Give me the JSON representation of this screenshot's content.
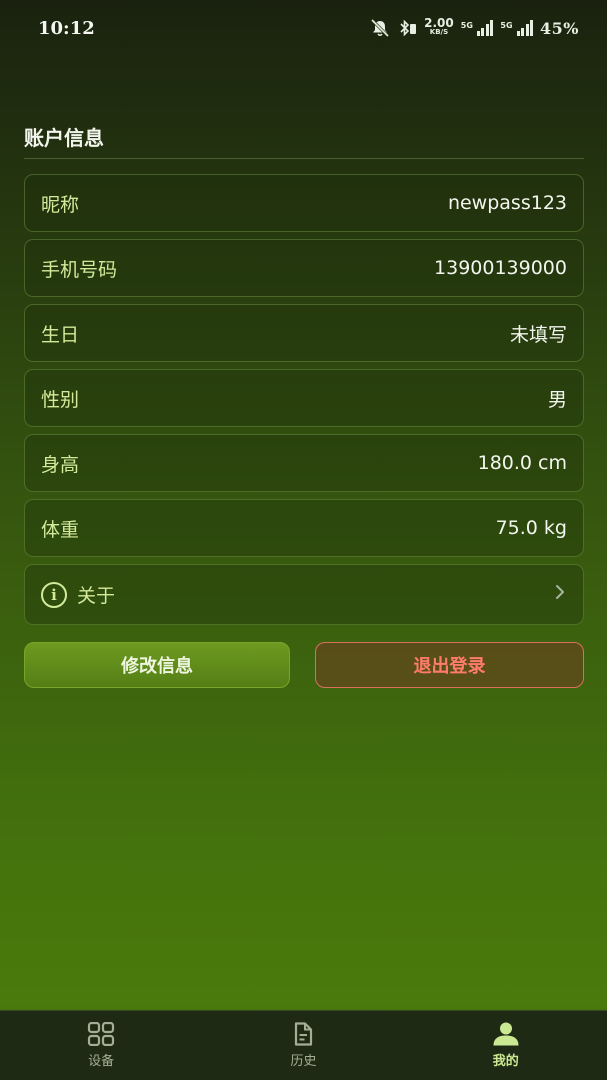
{
  "status_bar": {
    "time": "10:12",
    "speed_value": "2.00",
    "speed_unit": "KB/S",
    "net1": "5G",
    "net2": "5G",
    "battery": "45%"
  },
  "account": {
    "title": "账户信息",
    "rows": [
      {
        "label": "昵称",
        "value": "newpass123"
      },
      {
        "label": "手机号码",
        "value": "13900139000"
      },
      {
        "label": "生日",
        "value": "未填写"
      },
      {
        "label": "性别",
        "value": "男"
      },
      {
        "label": "身高",
        "value": "180.0 cm"
      },
      {
        "label": "体重",
        "value": "75.0 kg"
      }
    ],
    "about_label": "关于"
  },
  "actions": {
    "edit_label": "修改信息",
    "logout_label": "退出登录"
  },
  "tabbar": {
    "tabs": [
      {
        "label": "设备",
        "icon": "grid-icon"
      },
      {
        "label": "历史",
        "icon": "document-icon"
      },
      {
        "label": "我的",
        "icon": "person-icon",
        "active": true
      }
    ]
  },
  "colors": {
    "accent": "#cbe892",
    "logout": "#ff7c6a"
  }
}
